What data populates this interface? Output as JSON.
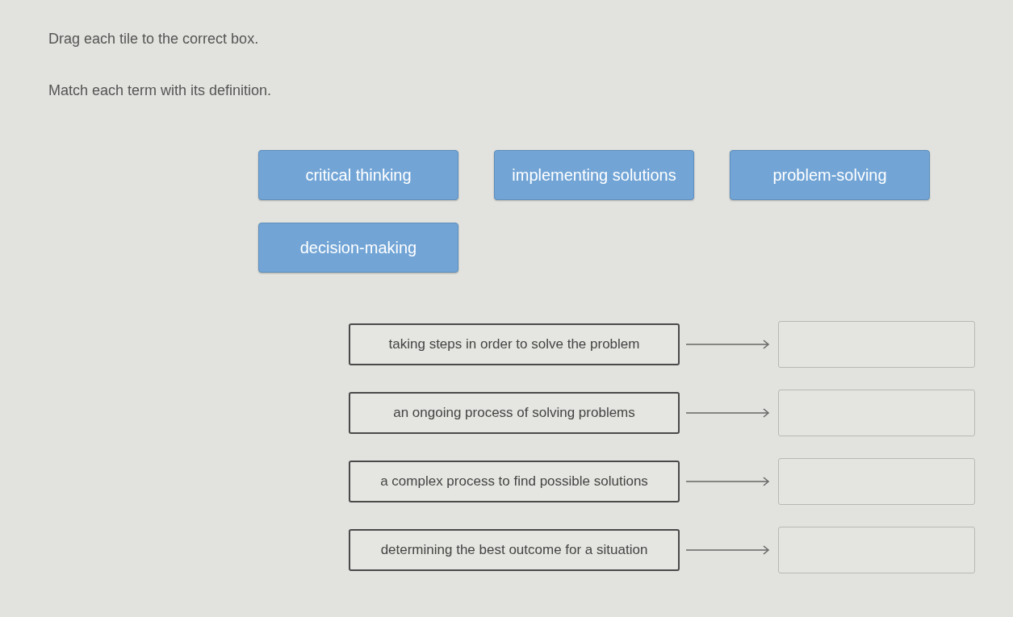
{
  "instructions": [
    "Drag each tile to the correct box.",
    "Match each term with its definition."
  ],
  "tiles": [
    {
      "label": "critical thinking"
    },
    {
      "label": "implementing solutions"
    },
    {
      "label": "problem-solving"
    },
    {
      "label": "decision-making"
    }
  ],
  "pairs": [
    {
      "definition": "taking steps in order to solve the problem"
    },
    {
      "definition": "an ongoing process of solving problems"
    },
    {
      "definition": "a complex process to find possible solutions"
    },
    {
      "definition": "determining the best outcome for a situation"
    }
  ]
}
